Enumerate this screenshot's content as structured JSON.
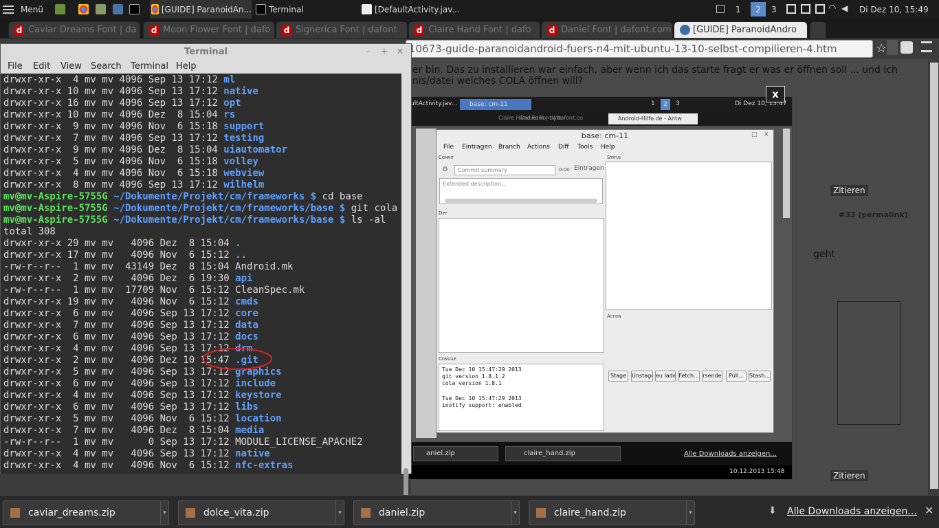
{
  "panel": {
    "menu_label": "Menü",
    "tasks": [
      "[GUIDE] ParanoidAn...",
      "Terminal",
      "[DefaultActivity.jav..."
    ],
    "workspaces": [
      "1",
      "2",
      "3"
    ],
    "clock": "Di Dez 10, 15:49"
  },
  "tabs": [
    {
      "label": "Caviar Dreams Font | da"
    },
    {
      "label": "Moon Flower Font | dafo"
    },
    {
      "label": "Signerica Font | dafont"
    },
    {
      "label": "Claire Hand Font | dafo"
    },
    {
      "label": "Daniel Font | dafont.com"
    },
    {
      "label": "[GUIDE] ParanoidAndro"
    }
  ],
  "url": "10673-guide-paranoidandroid-fuers-n4-mit-ubuntu-13-10-selbst-compilieren-4.htm",
  "page": {
    "line1": "er bin. Das zu installieren war einfach, aber wenn ich das starte fragt er was er öffnen soll ... und ich",
    "line2": "nis/datei welches COLA öffnen will?",
    "post_number": "#33 (permalink)",
    "geht": "geht",
    "zitieren": "Zitieren"
  },
  "terminal": {
    "title": "Terminal",
    "menu": [
      "File",
      "Edit",
      "View",
      "Search",
      "Terminal",
      "Help"
    ],
    "prompt_user": "mv@mv-Aspire-5755G",
    "lines": [
      {
        "meta": "drwxr-xr-x  4 mv mv 4096 Sep 13 17:12 ",
        "name": "ml",
        "dir": true
      },
      {
        "meta": "drwxr-xr-x 10 mv mv 4096 Sep 13 17:12 ",
        "name": "native",
        "dir": true
      },
      {
        "meta": "drwxr-xr-x 16 mv mv 4096 Sep 13 17:12 ",
        "name": "opt",
        "dir": true
      },
      {
        "meta": "drwxr-xr-x 10 mv mv 4096 Dez  8 15:04 ",
        "name": "rs",
        "dir": true
      },
      {
        "meta": "drwxr-xr-x  9 mv mv 4096 Nov  6 15:18 ",
        "name": "support",
        "dir": true
      },
      {
        "meta": "drwxr-xr-x  7 mv mv 4096 Sep 13 17:12 ",
        "name": "testing",
        "dir": true
      },
      {
        "meta": "drwxr-xr-x  9 mv mv 4096 Dez  8 15:04 ",
        "name": "uiautomator",
        "dir": true
      },
      {
        "meta": "drwxr-xr-x  5 mv mv 4096 Nov  6 15:18 ",
        "name": "volley",
        "dir": true
      },
      {
        "meta": "drwxr-xr-x  4 mv mv 4096 Nov  6 15:18 ",
        "name": "webview",
        "dir": true
      },
      {
        "meta": "drwxr-xr-x  8 mv mv 4096 Sep 13 17:12 ",
        "name": "wilhelm",
        "dir": true
      }
    ],
    "prompts": [
      {
        "path": " ~/Dokumente/Projekt/cm/frameworks $ ",
        "cmd": "cd base"
      },
      {
        "path": " ~/Dokumente/Projekt/cm/frameworks/base $ ",
        "cmd": "git cola"
      },
      {
        "path": " ~/Dokumente/Projekt/cm/frameworks/base $ ",
        "cmd": "ls -al"
      }
    ],
    "total": "total 308",
    "listing": [
      {
        "meta": "drwxr-xr-x 29 mv mv   4096 Dez  8 15:04 ",
        "name": ".",
        "dir": true
      },
      {
        "meta": "drwxr-xr-x 17 mv mv   4096 Nov  6 15:12 ",
        "name": "..",
        "dir": true
      },
      {
        "meta": "-rw-r--r--  1 mv mv  43149 Dez  8 15:04 ",
        "name": "Android.mk",
        "dir": false
      },
      {
        "meta": "drwxr-xr-x  2 mv mv   4096 Dez  6 19:30 ",
        "name": "api",
        "dir": true
      },
      {
        "meta": "-rw-r--r--  1 mv mv  17709 Nov  6 15:12 ",
        "name": "CleanSpec.mk",
        "dir": false
      },
      {
        "meta": "drwxr-xr-x 19 mv mv   4096 Nov  6 15:12 ",
        "name": "cmds",
        "dir": true
      },
      {
        "meta": "drwxr-xr-x  6 mv mv   4096 Sep 13 17:12 ",
        "name": "core",
        "dir": true
      },
      {
        "meta": "drwxr-xr-x  7 mv mv   4096 Sep 13 17:12 ",
        "name": "data",
        "dir": true
      },
      {
        "meta": "drwxr-xr-x  6 mv mv   4096 Sep 13 17:12 ",
        "name": "docs",
        "dir": true
      },
      {
        "meta": "drwxr-xr-x  4 mv mv   4096 Sep 13 17:12 ",
        "name": "drm",
        "dir": true
      },
      {
        "meta": "drwxr-xr-x  2 mv mv   4096 Dez 10 15:47 ",
        "name": ".git",
        "dir": true
      },
      {
        "meta": "drwxr-xr-x  5 mv mv   4096 Sep 13 17:12 ",
        "name": "graphics",
        "dir": true
      },
      {
        "meta": "drwxr-xr-x  6 mv mv   4096 Sep 13 17:12 ",
        "name": "include",
        "dir": true
      },
      {
        "meta": "drwxr-xr-x  4 mv mv   4096 Sep 13 17:12 ",
        "name": "keystore",
        "dir": true
      },
      {
        "meta": "drwxr-xr-x  6 mv mv   4096 Sep 13 17:12 ",
        "name": "libs",
        "dir": true
      },
      {
        "meta": "drwxr-xr-x  5 mv mv   4096 Nov  6 15:12 ",
        "name": "location",
        "dir": true
      },
      {
        "meta": "drwxr-xr-x  7 mv mv   4096 Dez  8 15:04 ",
        "name": "media",
        "dir": true
      },
      {
        "meta": "-rw-r--r--  1 mv mv      0 Sep 13 17:12 ",
        "name": "MODULE_LICENSE_APACHE2",
        "dir": false
      },
      {
        "meta": "drwxr-xr-x  4 mv mv   4096 Sep 13 17:12 ",
        "name": "native",
        "dir": true
      },
      {
        "meta": "drwxr-xr-x  4 mv mv   4096 Nov  6 15:12 ",
        "name": "nfc-extras",
        "dir": true
      }
    ]
  },
  "screenshot": {
    "tab_label": "ultActivity.jav...",
    "tab2_label": "base: cm-11",
    "workspaces": [
      "1",
      "2",
      "3"
    ],
    "clock": "Di Dez 10, 15:47",
    "tabs": [
      "Claire Hand Font | dafo",
      "Daniel Font | dafont.co",
      "Android-Hilfe.de - Antw"
    ],
    "downloads": [
      "aniel.zip",
      "claire_hand.zip"
    ],
    "all_downloads": "Alle Downloads anzeigen...",
    "footer_time": "10.12.2013 15:48",
    "close_label": "x"
  },
  "cola": {
    "title": "base: cm-11",
    "menu": [
      "File",
      "Eintragen",
      "Branch",
      "Actions",
      "Diff",
      "Tools",
      "Help"
    ],
    "commit_label": "Commit",
    "status_label": "Status",
    "diff_label": "Diff",
    "console_label": "Console",
    "action_label": "Action",
    "summary_placeholder": "Commit summary",
    "counter": "0:00",
    "eintragen_btn": "Eintragen",
    "description_placeholder": "Extended description...",
    "console_lines": [
      "Tue Dec 10 15:47:29 2013",
      "git version 1.8.1.2",
      "cola version 1.8.1",
      "",
      "Tue Dec 10 15:47:29 2013",
      "inotify support: enabled"
    ],
    "actions": [
      "Stage",
      "Unstage",
      "eu lade",
      "Fetch...",
      "rsende",
      "Pull...",
      "Stash..."
    ]
  },
  "downloads": {
    "items": [
      "caviar_dreams.zip",
      "dolce_vita.zip",
      "daniel.zip",
      "claire_hand.zip"
    ],
    "all_label": "Alle Downloads anzeigen..."
  },
  "colors": {
    "prompt": "#5ee05e",
    "directory": "#5fa0ff",
    "annotation": "#d22"
  }
}
